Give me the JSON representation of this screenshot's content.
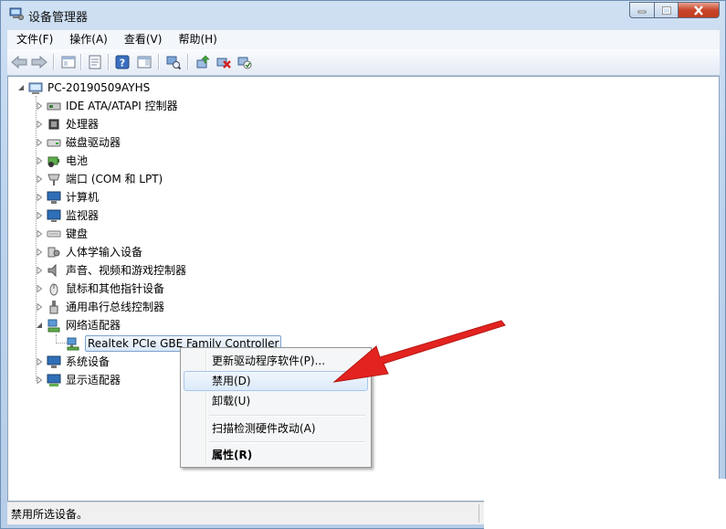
{
  "window": {
    "title": "设备管理器",
    "icon": "device-manager-icon",
    "controls": {
      "minimize": "minimize-icon",
      "maximize": "maximize-icon",
      "close": "close-icon"
    }
  },
  "menu": {
    "file": "文件(F)",
    "action": "操作(A)",
    "view": "查看(V)",
    "help": "帮助(H)"
  },
  "toolbar": {
    "icons": [
      "back-arrow-icon",
      "forward-arrow-icon",
      "show-hide-tree-icon",
      "properties-icon",
      "help-icon",
      "action-pane-icon",
      "scan-hardware-icon",
      "update-driver-icon",
      "uninstall-icon",
      "enable-device-icon"
    ]
  },
  "tree": {
    "root": "PC-20190509AYHS",
    "categories": [
      {
        "label": "IDE ATA/ATAPI 控制器",
        "icon": "ide-controller-icon"
      },
      {
        "label": "处理器",
        "icon": "processor-icon"
      },
      {
        "label": "磁盘驱动器",
        "icon": "disk-drive-icon"
      },
      {
        "label": "电池",
        "icon": "battery-icon"
      },
      {
        "label": "端口 (COM 和 LPT)",
        "icon": "port-icon"
      },
      {
        "label": "计算机",
        "icon": "computer-icon"
      },
      {
        "label": "监视器",
        "icon": "monitor-icon"
      },
      {
        "label": "键盘",
        "icon": "keyboard-icon"
      },
      {
        "label": "人体学输入设备",
        "icon": "hid-icon"
      },
      {
        "label": "声音、视频和游戏控制器",
        "icon": "sound-icon"
      },
      {
        "label": "鼠标和其他指针设备",
        "icon": "mouse-icon"
      },
      {
        "label": "通用串行总线控制器",
        "icon": "usb-icon"
      },
      {
        "label": "网络适配器",
        "icon": "network-adapter-icon",
        "expanded": true
      },
      {
        "label": "系统设备",
        "icon": "system-device-icon"
      },
      {
        "label": "显示适配器",
        "icon": "display-adapter-icon"
      }
    ],
    "selected_device": "Realtek PCIe GBE Family Controller"
  },
  "context_menu": {
    "update_driver": "更新驱动程序软件(P)...",
    "disable": "禁用(D)",
    "uninstall": "卸载(U)",
    "scan": "扫描检测硬件改动(A)",
    "properties": "属性(R)"
  },
  "status": {
    "text": "禁用所选设备。"
  },
  "colors": {
    "arrow": "#e3231f",
    "selection": "#dbe8f7",
    "frame": "#bcd3ee"
  }
}
